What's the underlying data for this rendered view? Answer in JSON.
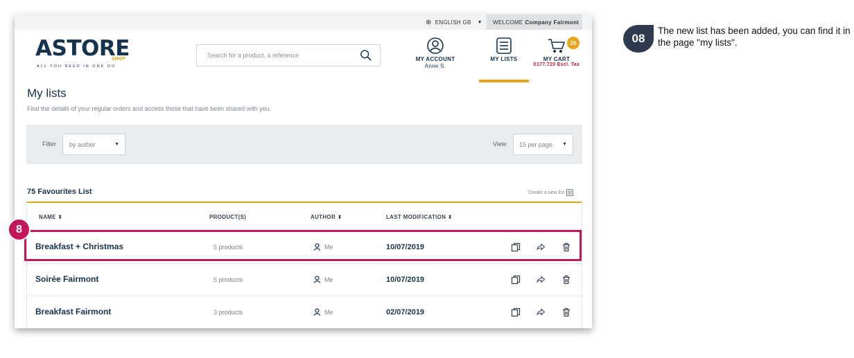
{
  "topbar": {
    "language": "ENGLISH GB",
    "welcome_prefix": "WELCOME",
    "welcome_company": "Company Fairmont"
  },
  "logo": {
    "main": "ASTORE",
    "shop": "SHOP",
    "tagline": "ALL YOU NEED IN ONE GO"
  },
  "search": {
    "placeholder": "Search for a product, a reference"
  },
  "nav": {
    "account_label": "MY ACCOUNT",
    "account_user": "Anne S.",
    "lists_label": "MY LISTS",
    "cart_label": "MY CART",
    "cart_price": "€177.720 Excl. Tax",
    "cart_count": "26"
  },
  "page": {
    "title": "My lists",
    "subtitle": "Find the details of your regular orders and access those that have been shared with you."
  },
  "filters": {
    "filter_label": "Filter",
    "filter_value": "by author",
    "view_label": "View",
    "view_value": "15 per page"
  },
  "list_section": {
    "count_label": "75 Favourites List",
    "create_link": "Create a new list"
  },
  "table": {
    "headers": {
      "name": "NAME ⬍",
      "products": "PRODUCT(S)",
      "author": "AUTHOR ⬍",
      "modification": "LAST MODIFICATION ⬍"
    },
    "rows": [
      {
        "name": "Breakfast + Christmas",
        "products": "5 products",
        "author": "Me",
        "date": "10/07/2019"
      },
      {
        "name": "Soirée Fairmont",
        "products": "5 products",
        "author": "Me",
        "date": "10/07/2019"
      },
      {
        "name": "Breakfast Fairmont",
        "products": "3 products",
        "author": "Me",
        "date": "02/07/2019"
      }
    ]
  },
  "step_marker": "8",
  "annotation": {
    "badge": "08",
    "text": "The new list has been added, you can find it in the page \"my lists\"."
  },
  "colors": {
    "accent": "#e8a317",
    "navy": "#17324d",
    "highlight": "#c2185b",
    "annotation_badge": "#2e3b4e"
  }
}
